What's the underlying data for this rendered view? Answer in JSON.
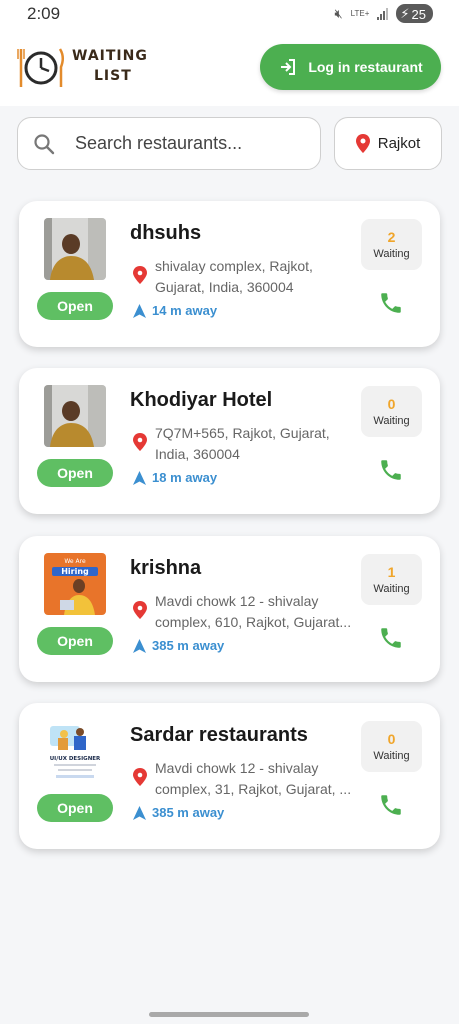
{
  "status_bar": {
    "time": "2:09",
    "network": "LTE+",
    "battery": "25"
  },
  "header": {
    "logo_line1": "WAITING",
    "logo_line2": "LIST",
    "login_button": "Log in restaurant"
  },
  "search": {
    "placeholder": "Search restaurants...",
    "value": ""
  },
  "location": {
    "city": "Rajkot"
  },
  "colors": {
    "accent_green": "#4caf50",
    "open_badge": "#5fbf63",
    "waiting_count": "#f0a52a",
    "distance_blue": "#3b8fd0",
    "pin_red": "#e53935"
  },
  "restaurants": [
    {
      "name": "dhsuhs",
      "address_line1": "shivalay complex, Rajkot,",
      "address_line2": "Gujarat, India, 360004",
      "distance": "14 m away",
      "status": "Open",
      "waiting_count": "2",
      "waiting_label": "Waiting",
      "thumb_icon": "person-photo"
    },
    {
      "name": "Khodiyar Hotel",
      "address_line1": "7Q7M+565, Rajkot, Gujarat,",
      "address_line2": "India, 360004",
      "distance": "18 m away",
      "status": "Open",
      "waiting_count": "0",
      "waiting_label": "Waiting",
      "thumb_icon": "person-photo"
    },
    {
      "name": "krishna",
      "address_line1": "Mavdi chowk 12 - shivalay",
      "address_line2": "complex, 610, Rajkot, Gujarat...",
      "distance": "385 m away",
      "status": "Open",
      "waiting_count": "1",
      "waiting_label": "Waiting",
      "thumb_icon": "hiring-poster",
      "thumb_text_1": "We Are",
      "thumb_text_2": "Hiring"
    },
    {
      "name": "Sardar restaurants",
      "address_line1": "Mavdi chowk 12 - shivalay",
      "address_line2": "complex, 31, Rajkot, Gujarat, ...",
      "distance": "385 m away",
      "status": "Open",
      "waiting_count": "0",
      "waiting_label": "Waiting",
      "thumb_icon": "designer-poster",
      "thumb_text_1": "UI/UX DESIGNER"
    }
  ]
}
